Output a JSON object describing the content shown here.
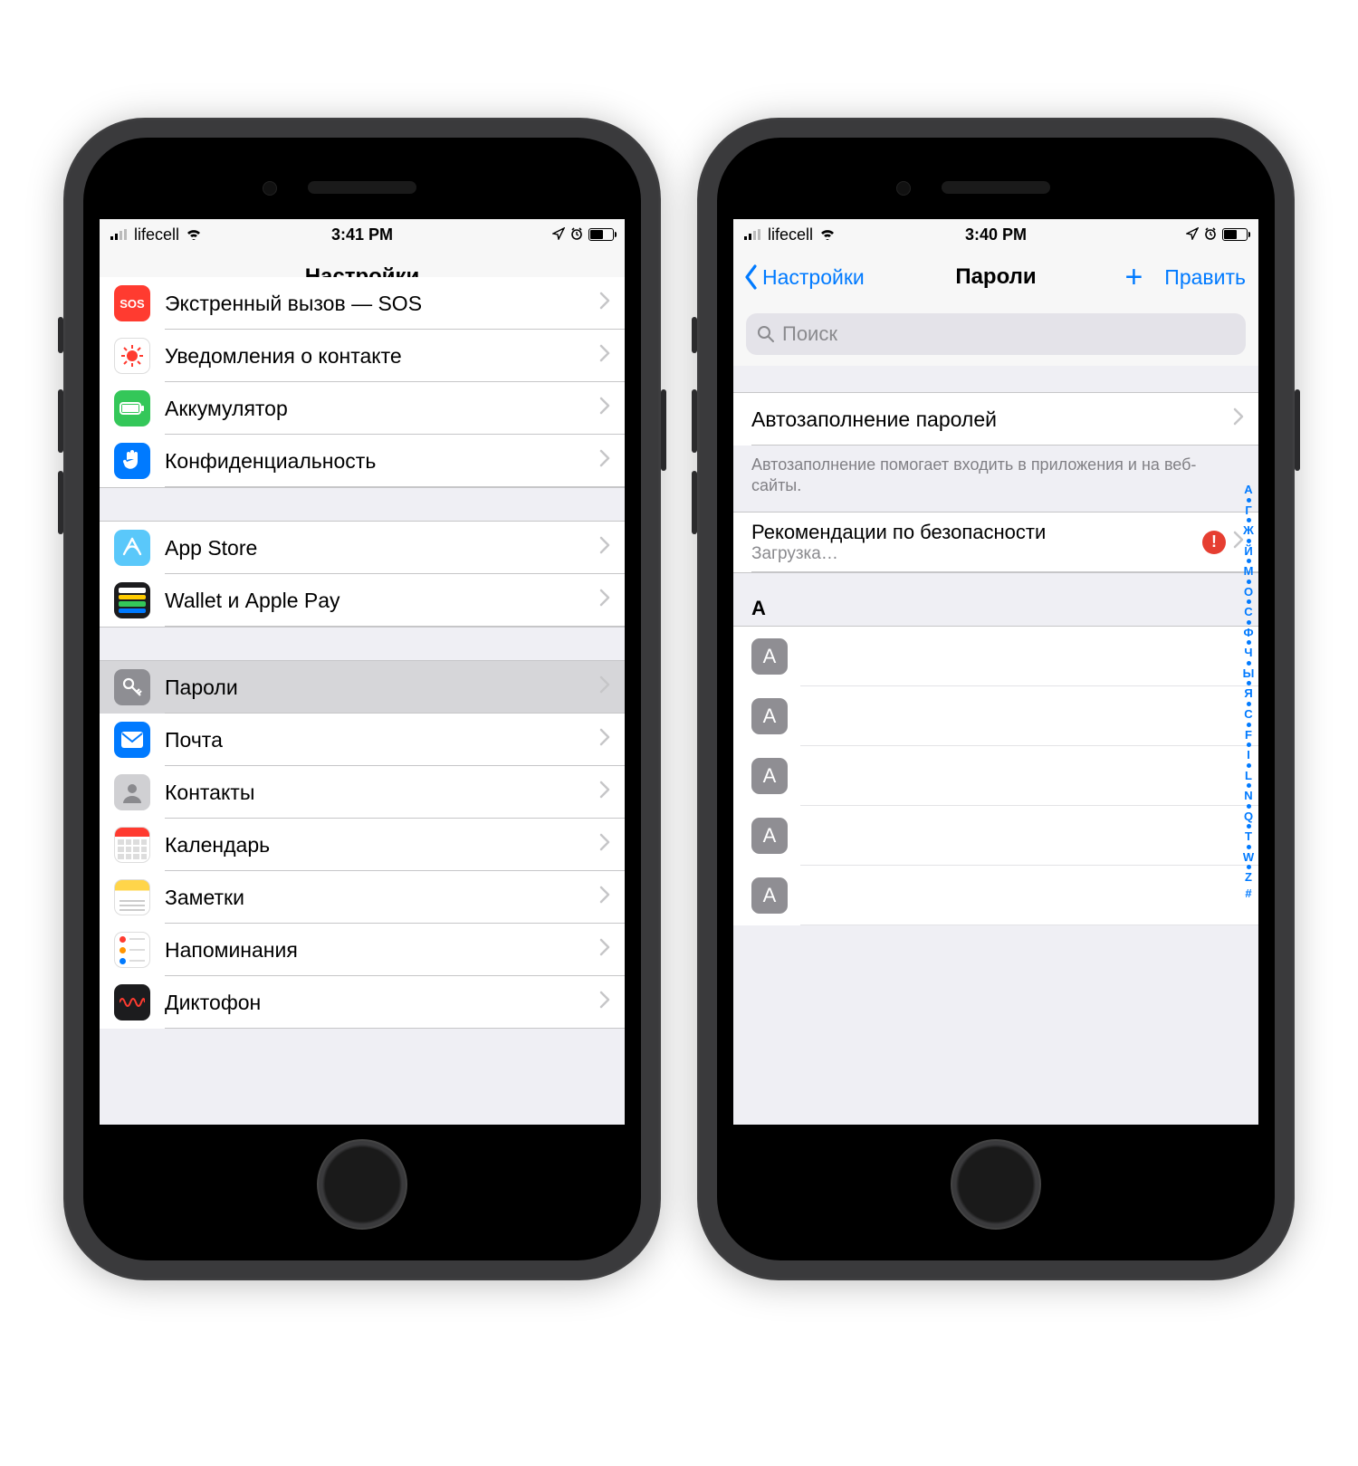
{
  "left": {
    "status": {
      "carrier": "lifecell",
      "time": "3:41 PM"
    },
    "title": "Настройки",
    "rows": [
      {
        "id": "sos",
        "label": "Экстренный вызов — SOS",
        "iconName": "sos-icon",
        "bg": "bg-red",
        "glyph": "SOS"
      },
      {
        "id": "exposure",
        "label": "Уведомления о контакте",
        "iconName": "exposure-icon",
        "bg": "bg-white",
        "glyph": "covid"
      },
      {
        "id": "battery",
        "label": "Аккумулятор",
        "iconName": "battery-icon",
        "bg": "bg-green",
        "glyph": "batt"
      },
      {
        "id": "privacy",
        "label": "Конфиденциальность",
        "iconName": "hand-icon",
        "bg": "bg-blue",
        "glyph": "hand"
      }
    ],
    "rows2": [
      {
        "id": "appstore",
        "label": "App Store",
        "iconName": "appstore-icon",
        "bg": "bg-lightb",
        "glyph": "A"
      },
      {
        "id": "wallet",
        "label": "Wallet и Apple Pay",
        "iconName": "wallet-icon",
        "bg": "",
        "glyph": "wallet"
      }
    ],
    "rows3": [
      {
        "id": "passwords",
        "label": "Пароли",
        "iconName": "key-icon",
        "bg": "bg-grey",
        "glyph": "key",
        "selected": true
      },
      {
        "id": "mail",
        "label": "Почта",
        "iconName": "mail-icon",
        "bg": "bg-blue",
        "glyph": "mail"
      },
      {
        "id": "contacts",
        "label": "Контакты",
        "iconName": "contacts-icon",
        "bg": "bg-lgrey",
        "glyph": "person"
      },
      {
        "id": "calendar",
        "label": "Календарь",
        "iconName": "calendar-icon",
        "bg": "bg-white",
        "glyph": "cal"
      },
      {
        "id": "notes",
        "label": "Заметки",
        "iconName": "notes-icon",
        "bg": "bg-white",
        "glyph": "notes"
      },
      {
        "id": "reminders",
        "label": "Напоминания",
        "iconName": "reminders-icon",
        "bg": "bg-white",
        "glyph": "rem"
      },
      {
        "id": "voice",
        "label": "Диктофон",
        "iconName": "voice-memo-icon",
        "bg": "",
        "glyph": "voice"
      }
    ]
  },
  "right": {
    "status": {
      "carrier": "lifecell",
      "time": "3:40 PM"
    },
    "back": "Настройки",
    "title": "Пароли",
    "edit": "Править",
    "searchPlaceholder": "Поиск",
    "autofill": {
      "label": "Автозаполнение паролей",
      "footer": "Автозаполнение помогает входить в приложения и на веб-сайты."
    },
    "security": {
      "label": "Рекомендации по безопасности",
      "sub": "Загрузка…"
    },
    "sectionHeader": "А",
    "items": [
      {
        "letter": "А"
      },
      {
        "letter": "А"
      },
      {
        "letter": "А"
      },
      {
        "letter": "А"
      },
      {
        "letter": "А"
      }
    ],
    "index": [
      "А",
      "•",
      "Г",
      "•",
      "Ж",
      "•",
      "Й",
      "•",
      "М",
      "•",
      "О",
      "•",
      "С",
      "•",
      "Ф",
      "•",
      "Ч",
      "•",
      "Ы",
      "•",
      "Я",
      "•",
      "C",
      "•",
      "F",
      "•",
      "I",
      "•",
      "L",
      "•",
      "N",
      "•",
      "Q",
      "•",
      "T",
      "•",
      "W",
      "•",
      "Z",
      "#"
    ]
  }
}
